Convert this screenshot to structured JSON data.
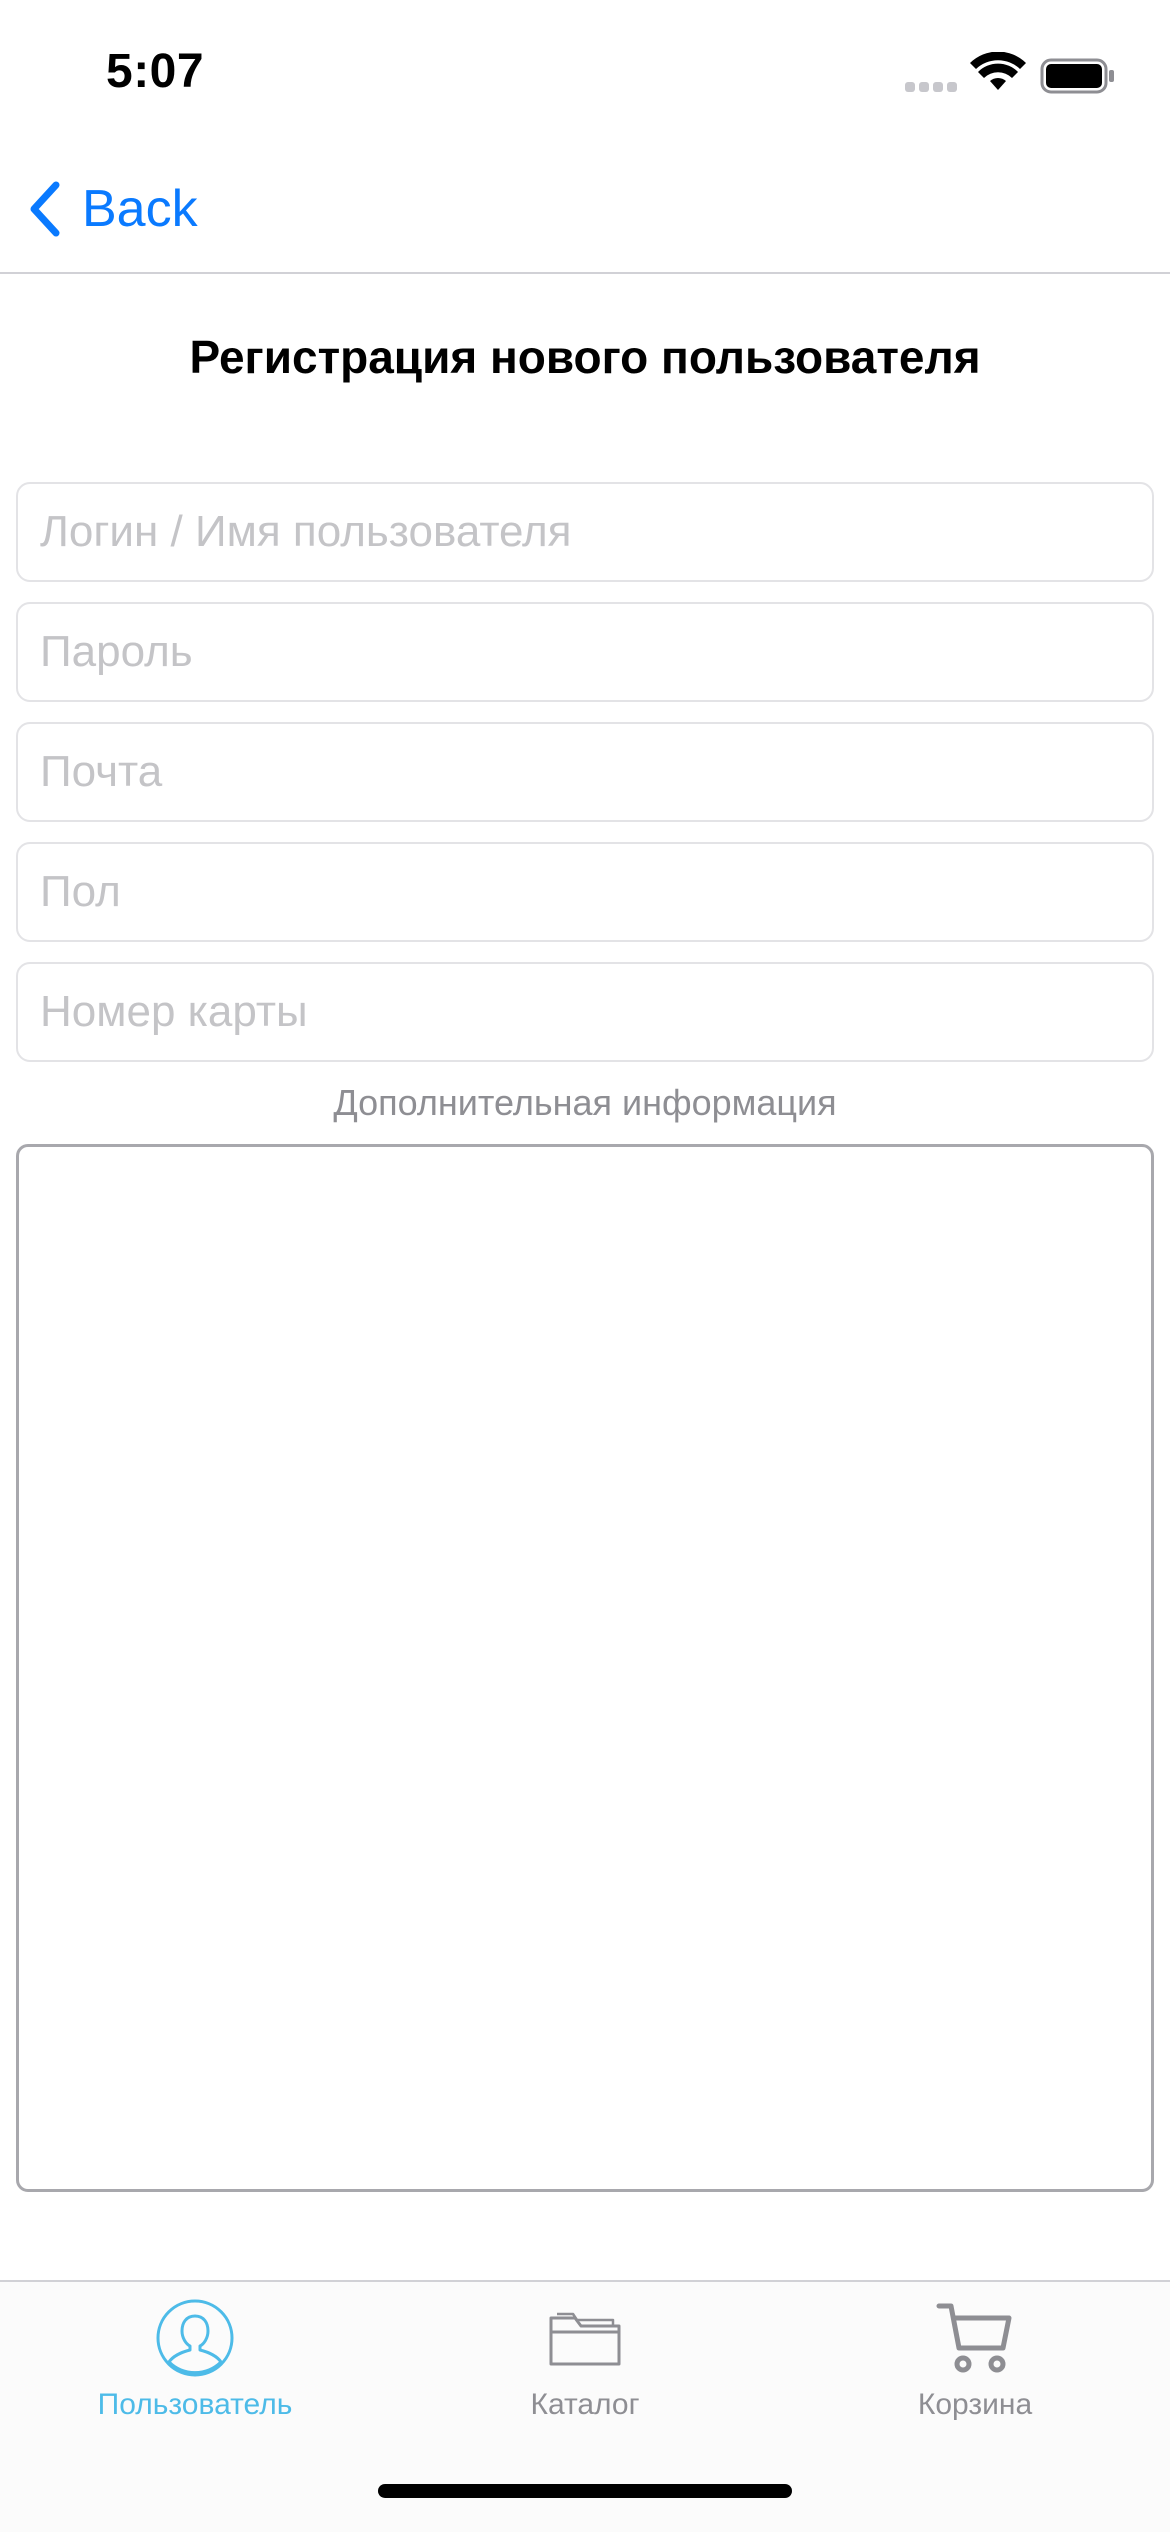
{
  "status_bar": {
    "time": "5:07",
    "icons": [
      "signal-icon",
      "wifi-icon",
      "battery-icon"
    ]
  },
  "nav": {
    "back_label": "Back",
    "back_icon": "chevron-left-icon",
    "accent_color": "#0a7aff"
  },
  "page": {
    "title": "Регистрация нового пользователя"
  },
  "form": {
    "login_placeholder": "Логин / Имя пользователя",
    "password_placeholder": "Пароль",
    "email_placeholder": "Почта",
    "gender_placeholder": "Пол",
    "card_placeholder": "Номер карты",
    "extra_label": "Дополнительная информация",
    "extra_value": ""
  },
  "tab_bar": {
    "active_color": "#4dbbe8",
    "inactive_color": "#8e8e93",
    "tabs": [
      {
        "label": "Пользователь",
        "icon": "user-icon",
        "active": true
      },
      {
        "label": "Каталог",
        "icon": "folder-icon",
        "active": false
      },
      {
        "label": "Корзина",
        "icon": "cart-icon",
        "active": false
      }
    ]
  }
}
